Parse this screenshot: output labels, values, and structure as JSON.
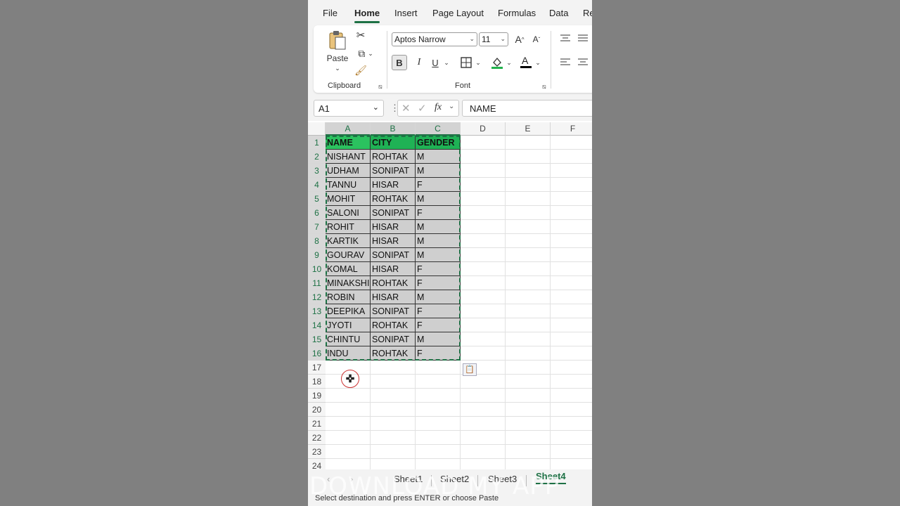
{
  "menu": {
    "tabs": [
      "File",
      "Home",
      "Insert",
      "Page Layout",
      "Formulas",
      "Data",
      "Re"
    ],
    "active": "Home"
  },
  "ribbon": {
    "clipboard": {
      "paste_label": "Paste",
      "group_label": "Clipboard"
    },
    "font": {
      "font_name": "Aptos Narrow",
      "font_size": "11",
      "bold": "B",
      "italic": "I",
      "underline": "U",
      "group_label": "Font"
    },
    "colors": {
      "fill": "#22b14c",
      "font": "#000000",
      "accent": "#1e7145"
    }
  },
  "formula_bar": {
    "name_box": "A1",
    "fx": "fx",
    "value": "NAME"
  },
  "columns": [
    "A",
    "B",
    "C",
    "D",
    "E",
    "F"
  ],
  "rows": [
    "1",
    "2",
    "3",
    "4",
    "5",
    "6",
    "7",
    "8",
    "9",
    "10",
    "11",
    "12",
    "13",
    "14",
    "15",
    "16",
    "17",
    "18",
    "19",
    "20",
    "21",
    "22",
    "23",
    "24"
  ],
  "table": {
    "headers": [
      "NAME",
      "CITY",
      "GENDER"
    ],
    "rows": [
      [
        "NISHANT",
        "ROHTAK",
        "M"
      ],
      [
        "UDHAM",
        "SONIPAT",
        "M"
      ],
      [
        "TANNU",
        "HISAR",
        "F"
      ],
      [
        "MOHIT",
        "ROHTAK",
        "M"
      ],
      [
        "SALONI",
        "SONIPAT",
        "F"
      ],
      [
        "ROHIT",
        "HISAR",
        "M"
      ],
      [
        "KARTIK",
        "HISAR",
        "M"
      ],
      [
        "GOURAV",
        "SONIPAT",
        "M"
      ],
      [
        "KOMAL",
        "HISAR",
        "F"
      ],
      [
        "MINAKSHI",
        "ROHTAK",
        "F"
      ],
      [
        "ROBIN",
        "HISAR",
        "M"
      ],
      [
        "DEEPIKA",
        "SONIPAT",
        "F"
      ],
      [
        "JYOTI",
        "ROHTAK",
        "F"
      ],
      [
        "CHINTU",
        "SONIPAT",
        "M"
      ],
      [
        "INDU",
        "ROHTAK",
        "F"
      ]
    ]
  },
  "sheets": [
    "Sheet1",
    "Sheet2",
    "Sheet3",
    "Sheet4"
  ],
  "active_sheet": "Sheet4",
  "status": "Select destination and press ENTER or choose Paste",
  "watermark": "DOWNLOAD MY APP"
}
